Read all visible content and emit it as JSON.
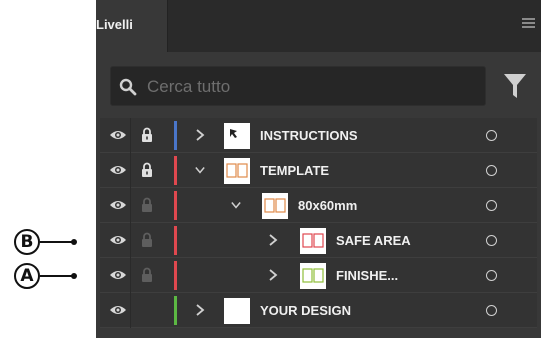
{
  "callouts": [
    {
      "letter": "B",
      "name": "callout-b"
    },
    {
      "letter": "A",
      "name": "callout-a"
    }
  ],
  "panel": {
    "tab_label": "Livelli",
    "search_placeholder": "Cerca tutto"
  },
  "layers": [
    {
      "label": "INSTRUCTIONS",
      "color": "#4a76c9",
      "expanded": false,
      "locked": true,
      "level": 0
    },
    {
      "label": "TEMPLATE",
      "color": "#e0484f",
      "expanded": true,
      "locked": true,
      "level": 0
    },
    {
      "label": "80x60mm",
      "color": "#e0484f",
      "expanded": true,
      "locked": false,
      "level": 1
    },
    {
      "label": "SAFE AREA",
      "color": "#e0484f",
      "expanded": false,
      "locked": false,
      "level": 2
    },
    {
      "label": "FINISHE...",
      "color": "#e0484f",
      "expanded": false,
      "locked": false,
      "level": 2
    },
    {
      "label": "YOUR DESIGN",
      "color": "#5cb843",
      "expanded": false,
      "locked": false,
      "level": 0
    }
  ]
}
